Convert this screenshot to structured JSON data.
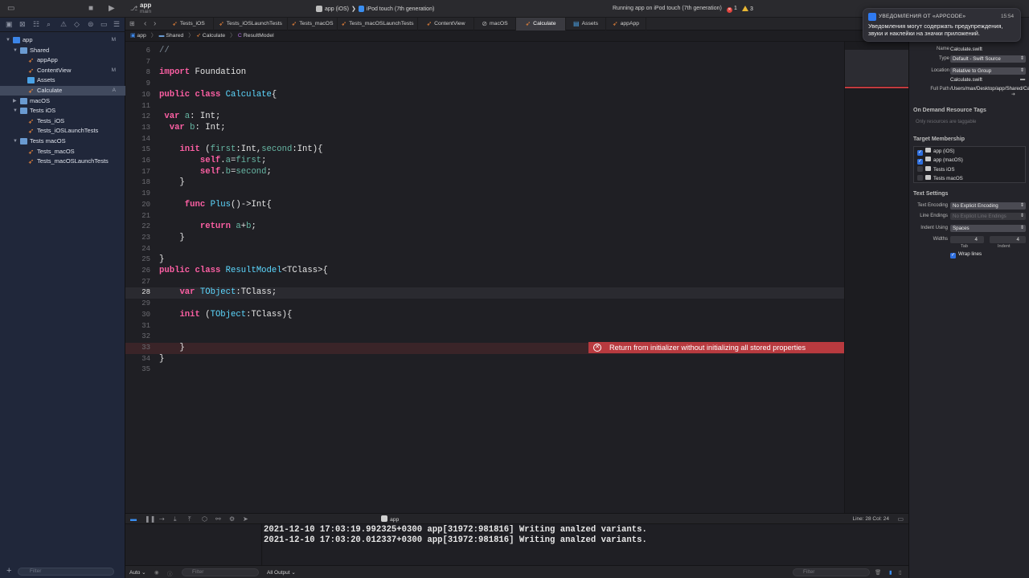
{
  "toolbar": {
    "scheme_title": "app",
    "scheme_branch": "main",
    "destination_scheme": "app (iOS)",
    "destination_device": "iPod touch (7th generation)",
    "status": "Running app on iPod touch (7th generation)",
    "error_count": "1",
    "warning_count": "3"
  },
  "navigator": {
    "filter_placeholder": "Filter",
    "tree": [
      {
        "label": "app",
        "badge": "M",
        "depth": 0,
        "kind": "project",
        "open": true
      },
      {
        "label": "Shared",
        "badge": "",
        "depth": 1,
        "kind": "folder",
        "open": true
      },
      {
        "label": "appApp",
        "badge": "",
        "depth": 2,
        "kind": "swift"
      },
      {
        "label": "ContentView",
        "badge": "M",
        "depth": 2,
        "kind": "swift"
      },
      {
        "label": "Assets",
        "badge": "",
        "depth": 2,
        "kind": "xcassets"
      },
      {
        "label": "Calculate",
        "badge": "A",
        "depth": 2,
        "kind": "swift",
        "selected": true
      },
      {
        "label": "macOS",
        "badge": "",
        "depth": 1,
        "kind": "folder",
        "open": false
      },
      {
        "label": "Tests iOS",
        "badge": "",
        "depth": 1,
        "kind": "folder",
        "open": true
      },
      {
        "label": "Tests_iOS",
        "badge": "",
        "depth": 2,
        "kind": "swift"
      },
      {
        "label": "Tests_iOSLaunchTests",
        "badge": "",
        "depth": 2,
        "kind": "swift"
      },
      {
        "label": "Tests macOS",
        "badge": "",
        "depth": 1,
        "kind": "folder",
        "open": true
      },
      {
        "label": "Tests_macOS",
        "badge": "",
        "depth": 2,
        "kind": "swift"
      },
      {
        "label": "Tests_macOSLaunchTests",
        "badge": "",
        "depth": 2,
        "kind": "swift"
      }
    ]
  },
  "tabs": [
    "Tests_iOS",
    "Tests_iOSLaunchTests",
    "Tests_macOS",
    "Tests_macOSLaunchTests",
    "ContentView",
    "macOS",
    "Calculate",
    "Assets",
    "appApp"
  ],
  "active_tab": "Calculate",
  "breadcrumb": [
    "app",
    "Shared",
    "Calculate",
    "ResultModel"
  ],
  "editor": {
    "current_line": "28",
    "error_line": "33",
    "error_message": "Return from initializer without initializing all stored properties",
    "lines": [
      {
        "n": "6",
        "code": "//"
      },
      {
        "n": "7",
        "code": ""
      },
      {
        "n": "8",
        "code": "import Foundation"
      },
      {
        "n": "9",
        "code": ""
      },
      {
        "n": "10",
        "code": "public class Calculate{"
      },
      {
        "n": "11",
        "code": ""
      },
      {
        "n": "12",
        "code": " var a: Int;"
      },
      {
        "n": "13",
        "code": "  var b: Int;"
      },
      {
        "n": "14",
        "code": ""
      },
      {
        "n": "15",
        "code": "    init (first:Int,second:Int){"
      },
      {
        "n": "16",
        "code": "        self.a=first;"
      },
      {
        "n": "17",
        "code": "        self.b=second;"
      },
      {
        "n": "18",
        "code": "    }"
      },
      {
        "n": "19",
        "code": ""
      },
      {
        "n": "20",
        "code": "     func Plus()->Int{"
      },
      {
        "n": "21",
        "code": ""
      },
      {
        "n": "22",
        "code": "        return a+b;"
      },
      {
        "n": "23",
        "code": "    }"
      },
      {
        "n": "24",
        "code": ""
      },
      {
        "n": "25",
        "code": "}"
      },
      {
        "n": "26",
        "code": "public class ResultModel<TClass>{"
      },
      {
        "n": "27",
        "code": ""
      },
      {
        "n": "28",
        "code": "    var TObject:TClass;"
      },
      {
        "n": "29",
        "code": ""
      },
      {
        "n": "30",
        "code": "    init (TObject:TClass){"
      },
      {
        "n": "31",
        "code": ""
      },
      {
        "n": "32",
        "code": ""
      },
      {
        "n": "33",
        "code": "    }"
      },
      {
        "n": "34",
        "code": "}"
      },
      {
        "n": "35",
        "code": ""
      }
    ]
  },
  "debug": {
    "app_label": "app",
    "line_col": "Line: 28  Col: 24",
    "console_lines": [
      "2021-12-10 17:03:19.992325+0300 app[31972:981816] Writing analzed variants.",
      "2021-12-10 17:03:20.012337+0300 app[31972:981816] Writing analzed variants."
    ],
    "auto_label": "Auto",
    "vars_filter_placeholder": "Filter",
    "output_label": "All Output",
    "console_filter_placeholder": "Filter"
  },
  "inspector": {
    "name_label": "Name",
    "name_value": "Calculate.swift",
    "type_label": "Type",
    "type_value": "Default - Swift Source",
    "location_label": "Location",
    "location_value": "Relative to Group",
    "location_file": "Calculate.swift",
    "fullpath_label": "Full Path",
    "fullpath_value": "/Users/max/Desktop/app/Shared/Calculate.swift",
    "odr_title": "On Demand Resource Tags",
    "odr_placeholder": "Only resources are taggable",
    "membership_title": "Target Membership",
    "membership": [
      {
        "label": "app (iOS)",
        "checked": true
      },
      {
        "label": "app (macOS)",
        "checked": true
      },
      {
        "label": "Tests iOS",
        "checked": false
      },
      {
        "label": "Tests macOS",
        "checked": false
      }
    ],
    "text_settings_title": "Text Settings",
    "encoding_label": "Text Encoding",
    "encoding_value": "No Explicit Encoding",
    "endings_label": "Line Endings",
    "endings_value": "No Explicit Line Endings",
    "indent_label": "Indent Using",
    "indent_value": "Spaces",
    "widths_label": "Widths",
    "tab_width": "4",
    "indent_width": "4",
    "tab_caption": "Tab",
    "indent_caption": "Indent",
    "wrap_label": "Wrap lines"
  },
  "notification": {
    "title": "УВЕДОМЛЕНИЯ ОТ «APPCODE»",
    "time": "15:54",
    "body": "Уведомления могут содержать предупреждения, звуки и наклейки на значки приложений."
  },
  "colors": {
    "accent": "#2f6fde",
    "error": "#b83a3f",
    "keyword": "#fc5fa3",
    "type": "#5dd8ff"
  }
}
